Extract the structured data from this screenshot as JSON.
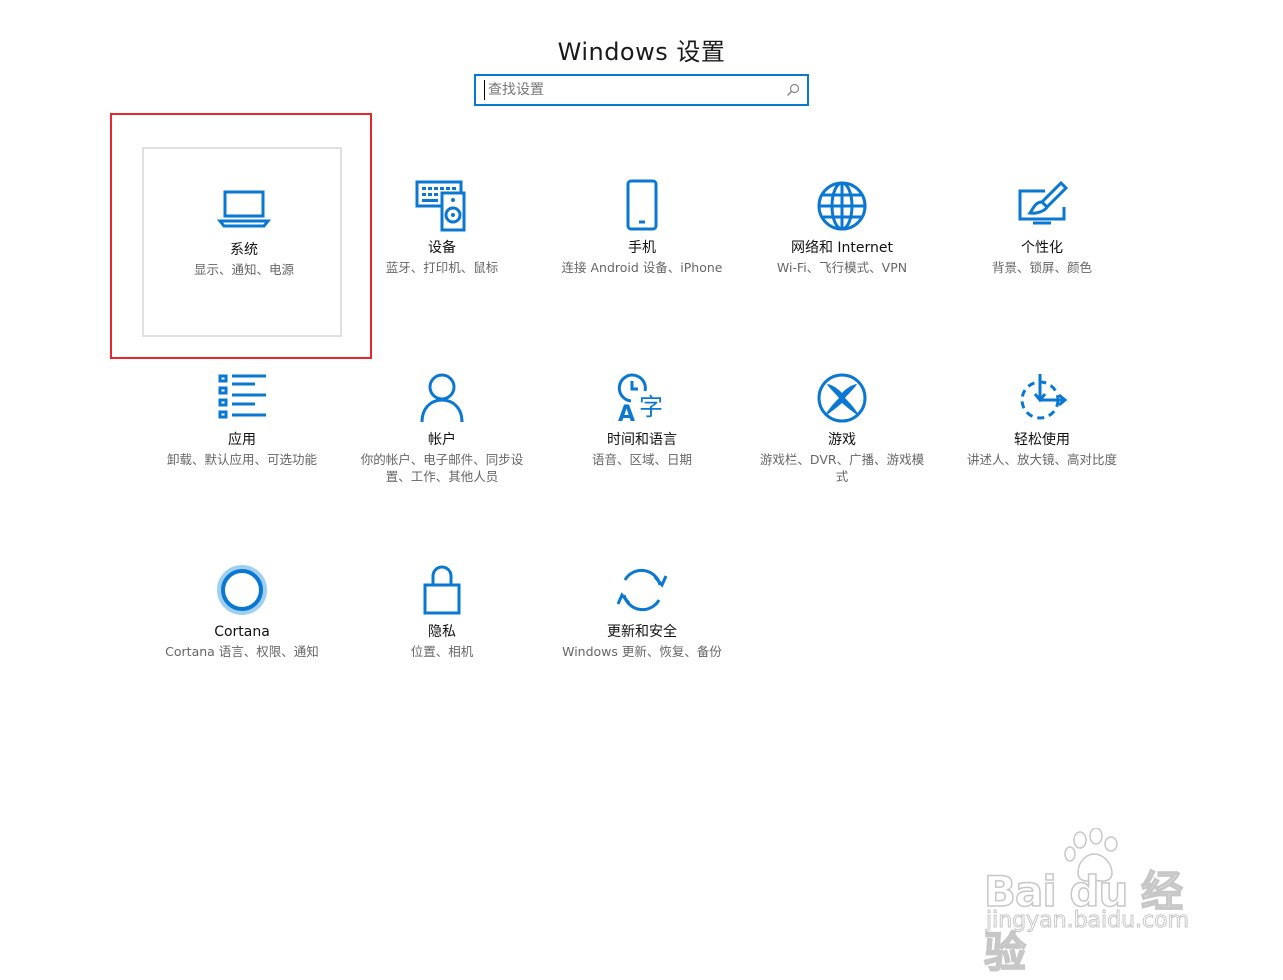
{
  "window": {
    "title": "Windows 设置"
  },
  "search": {
    "placeholder": "查找设置",
    "value": ""
  },
  "colors": {
    "accent": "#0a78d2",
    "highlight": "#e8262c"
  },
  "tiles": [
    {
      "title": "系统",
      "desc": "显示、通知、电源",
      "icon": "laptop-icon",
      "selected": true
    },
    {
      "title": "设备",
      "desc": "蓝牙、打印机、鼠标",
      "icon": "devices-icon"
    },
    {
      "title": "手机",
      "desc": "连接 Android 设备、iPhone",
      "icon": "phone-icon"
    },
    {
      "title": "网络和 Internet",
      "desc": "Wi-Fi、飞行模式、VPN",
      "icon": "globe-icon"
    },
    {
      "title": "个性化",
      "desc": "背景、锁屏、颜色",
      "icon": "paint-icon"
    },
    {
      "title": "应用",
      "desc": "卸载、默认应用、可选功能",
      "icon": "apps-list-icon"
    },
    {
      "title": "帐户",
      "desc": "你的帐户、电子邮件、同步设置、工作、其他人员",
      "icon": "person-icon"
    },
    {
      "title": "时间和语言",
      "desc": "语音、区域、日期",
      "icon": "time-language-icon"
    },
    {
      "title": "游戏",
      "desc": "游戏栏、DVR、广播、游戏模式",
      "icon": "xbox-icon"
    },
    {
      "title": "轻松使用",
      "desc": "讲述人、放大镜、高对比度",
      "icon": "ease-of-access-icon"
    },
    {
      "title": "Cortana",
      "desc": "Cortana 语言、权限、通知",
      "icon": "cortana-icon"
    },
    {
      "title": "隐私",
      "desc": "位置、相机",
      "icon": "lock-icon"
    },
    {
      "title": "更新和安全",
      "desc": "Windows 更新、恢复、备份",
      "icon": "sync-icon"
    }
  ],
  "watermark": {
    "brand": "Bai du 经验",
    "url": "jingyan.baidu.com"
  }
}
